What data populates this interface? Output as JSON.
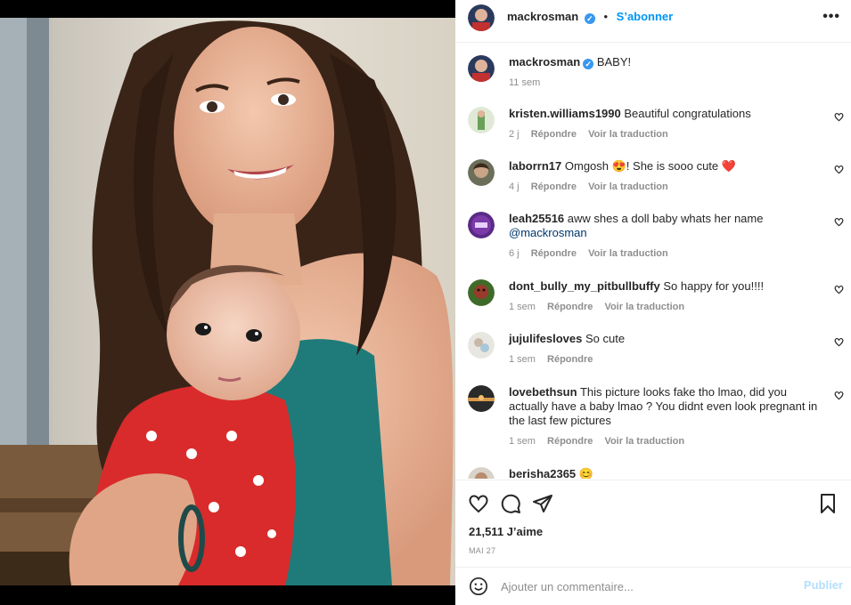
{
  "post": {
    "author": "mackrosman",
    "follow_label": "S’abonner",
    "caption": "BABY!",
    "caption_time": "11 sem"
  },
  "comments": [
    {
      "user": "kristen.williams1990",
      "text": "Beautiful congratulations",
      "time": "2 j",
      "reply": "Répondre",
      "translate": "Voir la traduction"
    },
    {
      "user": "laborrn17",
      "text": "Omgosh 😍! She is sooo cute ❤️",
      "time": "4 j",
      "reply": "Répondre",
      "translate": "Voir la traduction"
    },
    {
      "user": "leah25516",
      "text": "aww shes a doll baby whats her name",
      "mention": "@mackrosman",
      "time": "6 j",
      "reply": "Répondre",
      "translate": "Voir la traduction"
    },
    {
      "user": "dont_bully_my_pitbullbuffy",
      "text": "So happy for you!!!!",
      "time": "1 sem",
      "reply": "Répondre",
      "translate": "Voir la traduction"
    },
    {
      "user": "jujulifesloves",
      "text": "So cute",
      "time": "1 sem",
      "reply": "Répondre"
    },
    {
      "user": "lovebethsun",
      "text": "This picture looks fake tho lmao, did you actually have a baby lmao ? You didnt even look pregnant in the last few pictures",
      "time": "1 sem",
      "reply": "Répondre",
      "translate": "Voir la traduction"
    },
    {
      "user": "berisha2365",
      "text": "😊"
    }
  ],
  "footer": {
    "likes": "21,511 J’aime",
    "date": "MAI 27",
    "comment_placeholder": "Ajouter un commentaire...",
    "publish_label": "Publier"
  },
  "icons": {
    "more": "more-options-icon",
    "verified": "verified-badge-icon",
    "heart": "heart-icon",
    "comment": "comment-icon",
    "share": "share-icon",
    "save": "bookmark-icon",
    "emoji": "emoji-icon"
  },
  "colors": {
    "follow": "#0095f6",
    "verified": "#3897f0",
    "publish_disabled": "#b2dffc",
    "meta": "#8e8e8e"
  }
}
